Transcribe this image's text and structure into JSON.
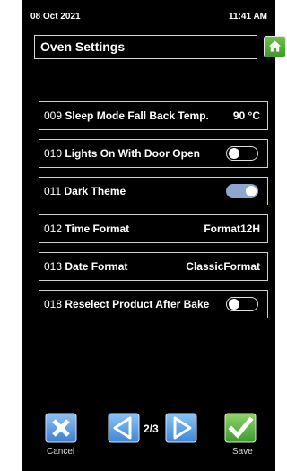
{
  "status": {
    "date": "08 Oct 2021",
    "time": "11:41 AM"
  },
  "header": {
    "title": "Oven Settings",
    "home_icon": "home-icon"
  },
  "settings": [
    {
      "number": "009",
      "label": "Sleep Mode Fall Back Temp.",
      "value": "90 °C",
      "type": "value"
    },
    {
      "number": "010",
      "label": "Lights On With Door Open",
      "type": "toggle",
      "state": "off"
    },
    {
      "number": "011",
      "label": "Dark Theme",
      "type": "toggle",
      "state": "on"
    },
    {
      "number": "012",
      "label": "Time Format",
      "value": "Format12H",
      "type": "value"
    },
    {
      "number": "013",
      "label": "Date Format",
      "value": "ClassicFormat",
      "type": "value"
    },
    {
      "number": "018",
      "label": "Reselect Product After Bake",
      "type": "toggle",
      "state": "off"
    }
  ],
  "footer": {
    "cancel_label": "Cancel",
    "save_label": "Save",
    "page_indicator": "2/3",
    "current_page": 2,
    "total_pages": 3
  },
  "colors": {
    "background": "#000000",
    "cancel": "#4f8fd8",
    "nav": "#4a90e0",
    "save": "#4fa83a",
    "toggle_on": "#8fa6cf"
  }
}
